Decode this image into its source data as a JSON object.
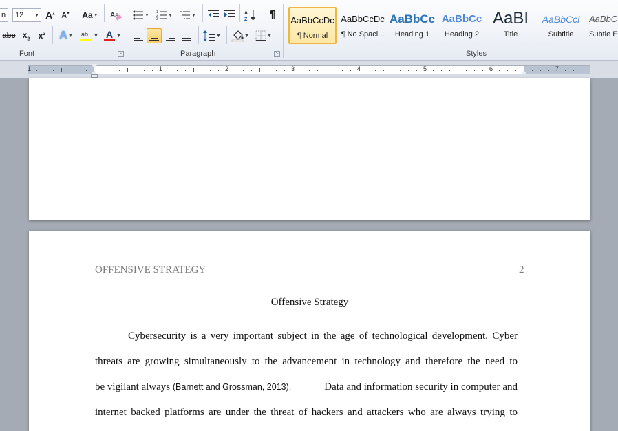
{
  "font": {
    "size_value": "12",
    "font_name_partial": "n",
    "group_label": "Font"
  },
  "paragraph": {
    "group_label": "Paragraph"
  },
  "styles": {
    "group_label": "Styles",
    "items": [
      {
        "sample": "AaBbCcDc",
        "name": "¶ Normal"
      },
      {
        "sample": "AaBbCcDc",
        "name": "¶ No Spaci..."
      },
      {
        "sample": "AaBbCc",
        "name": "Heading 1"
      },
      {
        "sample": "AaBbCc",
        "name": "Heading 2"
      },
      {
        "sample": "AaBI",
        "name": "Title"
      },
      {
        "sample": "AaBbCcl",
        "name": "Subtitle"
      },
      {
        "sample": "AaBbC",
        "name": "Subtle E"
      }
    ]
  },
  "ruler": {
    "numbers": [
      "1",
      "1",
      "2",
      "3",
      "4",
      "5",
      "6",
      "7"
    ]
  },
  "document": {
    "header_text": "OFFENSIVE STRATEGY",
    "page_number": "2",
    "title": "Offensive Strategy",
    "lines": [
      "Cybersecurity is a very important subject in the age of technological development. Cyber",
      "threats are growing simultaneously to the advancement in technology and therefore the need to",
      "be vigilant always",
      "Data and information security in computer and",
      "internet backed platforms are under the threat of hackers and attackers who are always trying to"
    ],
    "citation": "(Barnett  and Grossman, 2013)."
  },
  "colors": {
    "ribbon_bg": "#e6ebf3",
    "doc_bg": "#a5abb4",
    "active_highlight": "#f9cf6b",
    "heading_blue": "#2e74b5",
    "font_color_red": "#e02020",
    "highlight_yellow": "#ffff00"
  }
}
